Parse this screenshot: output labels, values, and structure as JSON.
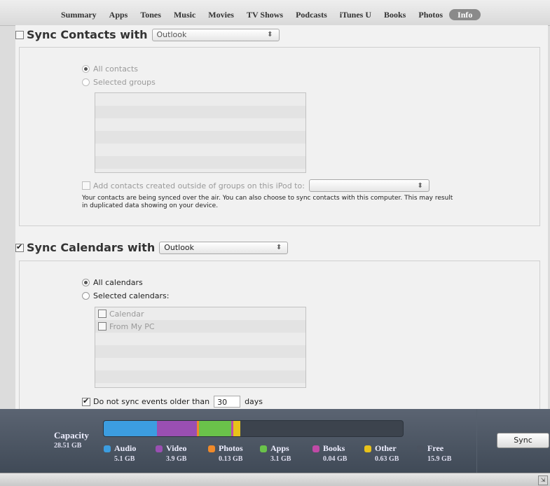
{
  "tabs": [
    "Summary",
    "Apps",
    "Tones",
    "Music",
    "Movies",
    "TV Shows",
    "Podcasts",
    "iTunes U",
    "Books",
    "Photos",
    "Info"
  ],
  "active_tab": "Info",
  "contacts": {
    "title": "Sync Contacts with",
    "source": "Outlook",
    "checked": false,
    "all_label": "All contacts",
    "selected_label": "Selected groups",
    "add_outside_label": "Add contacts created outside of groups on this iPod to:",
    "note_line1": "Your contacts are being synced over the air. You can also choose to sync contacts with this computer. This may result",
    "note_line2": "in duplicated data showing on your device."
  },
  "calendars": {
    "title": "Sync Calendars with",
    "source": "Outlook",
    "checked": true,
    "all_label": "All calendars",
    "selected_label": "Selected calendars:",
    "items": [
      "Calendar",
      "From My PC"
    ],
    "older_label": "Do not sync events older than",
    "older_value": "30",
    "days_label": "days"
  },
  "capacity": {
    "title": "Capacity",
    "total": "28.51 GB",
    "segments": [
      {
        "name": "Audio",
        "value": "5.1 GB",
        "color": "#3c9de0",
        "gb": 5.1
      },
      {
        "name": "Video",
        "value": "3.9 GB",
        "color": "#9a4fb2",
        "gb": 3.9
      },
      {
        "name": "Photos",
        "value": "0.13 GB",
        "color": "#f08a2a",
        "gb": 0.13
      },
      {
        "name": "Apps",
        "value": "3.1 GB",
        "color": "#6ac24a",
        "gb": 3.1
      },
      {
        "name": "Books",
        "value": "0.04 GB",
        "color": "#c04aa6",
        "gb": 0.04
      },
      {
        "name": "Other",
        "value": "0.63 GB",
        "color": "#e8c21a",
        "gb": 0.63
      },
      {
        "name": "Free",
        "value": "15.9 GB",
        "color": "#4b5360",
        "gb": 15.9
      }
    ]
  },
  "sync_button": "Sync"
}
